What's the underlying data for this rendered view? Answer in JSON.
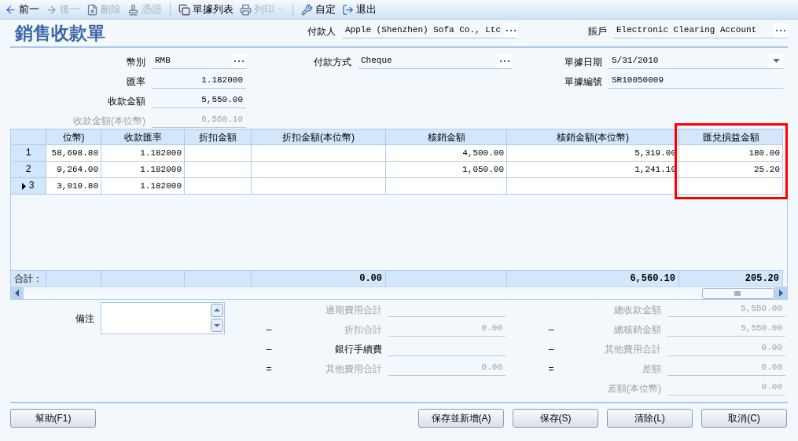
{
  "toolbar": [
    [
      {
        "label": "前一",
        "disabled": false
      },
      {
        "label": "後一",
        "disabled": true
      },
      {
        "label": "刪除",
        "disabled": true
      },
      {
        "label": "憑證",
        "disabled": true
      }
    ],
    [
      {
        "label": "單據列表",
        "disabled": false
      },
      {
        "label": "列印",
        "disabled": true,
        "dropdown": true
      }
    ],
    [
      {
        "label": "自定",
        "disabled": false
      },
      {
        "label": "退出",
        "disabled": false
      }
    ]
  ],
  "title": "銷售收款單",
  "title_fields": [
    {
      "label": "付款人",
      "value": "Apple (Shenzhen) Sofa Co., Ltc",
      "kind": "lookup",
      "disabled": false
    },
    {
      "label": "賬戶",
      "value": "Electronic Clearing Account",
      "kind": "lookup",
      "disabled": false
    }
  ],
  "form_columns": [
    [
      {
        "label": "幣別",
        "value": "RMB",
        "kind": "lookup",
        "disabled": false
      },
      {
        "label": "匯率",
        "value": "1.182000",
        "kind": "number",
        "disabled": false
      },
      {
        "label": "收款金額",
        "value": "5,550.00",
        "kind": "number",
        "disabled": false
      },
      {
        "label": "收款金額(本位幣)",
        "value": "6,560.10",
        "kind": "number",
        "disabled": true
      }
    ],
    [
      {
        "label": "付款方式",
        "value": "Cheque",
        "kind": "lookup",
        "disabled": false
      }
    ],
    [
      {
        "label": "單據日期",
        "value": "5/31/2010",
        "kind": "date",
        "disabled": false
      },
      {
        "label": "單據編號",
        "value": "SR10050009",
        "kind": "text",
        "disabled": false
      }
    ]
  ],
  "grid": {
    "columns": [
      {
        "label": "位幣)",
        "highlighted": false
      },
      {
        "label": "收款匯率",
        "highlighted": false
      },
      {
        "label": "折扣金額",
        "highlighted": false
      },
      {
        "label": "折扣金額(本位幣)",
        "highlighted": false
      },
      {
        "label": "核銷金額",
        "highlighted": false
      },
      {
        "label": "核銷金額(本位幣)",
        "highlighted": false
      },
      {
        "label": "匯兌損益金額",
        "highlighted": true
      }
    ],
    "rows": [
      {
        "number": "1",
        "current": false,
        "cells": [
          "58,698.80",
          "1.182000",
          null,
          null,
          "4,500.00",
          "5,319.00",
          "180.00"
        ]
      },
      {
        "number": "2",
        "current": false,
        "cells": [
          "9,264.00",
          "1.182000",
          null,
          null,
          "1,050.00",
          "1,241.10",
          "25.20"
        ]
      },
      {
        "number": "3",
        "current": true,
        "cells": [
          "3,010.80",
          "1.182000",
          null,
          null,
          null,
          null,
          null
        ]
      }
    ],
    "totals": {
      "label": "合計：",
      "cells": [
        null,
        null,
        null,
        "0.00",
        null,
        "6,560.10",
        "205.20"
      ]
    }
  },
  "remark": {
    "label": "備注"
  },
  "summary_middle": [
    {
      "label": "過期費用合計",
      "disabled": true
    },
    {
      "op": "–",
      "label": "折扣合計",
      "value": "0.00",
      "disabled": true
    },
    {
      "op": "–",
      "label": "銀行手續費",
      "disabled": false
    },
    {
      "op": "=",
      "label": "其他費用合計",
      "value": "0.00",
      "disabled": true
    }
  ],
  "summary_right": [
    {
      "label": "總收款金額",
      "value": "5,550.00",
      "disabled": true
    },
    {
      "op": "–",
      "label": "總核銷金額",
      "value": "5,550.00",
      "disabled": true
    },
    {
      "op": "–",
      "label": "其他費用合計",
      "value": "0.00",
      "disabled": true
    },
    {
      "op": "=",
      "label": "差額",
      "value": "0.00",
      "disabled": true
    },
    {
      "label": "差額(本位幣)",
      "value": "0.00",
      "disabled": true
    }
  ],
  "buttons_left": [
    "幫助(F1)"
  ],
  "buttons_right": [
    "保存並新增(A)",
    "保存(S)",
    "清除(L)",
    "取消(C)"
  ]
}
